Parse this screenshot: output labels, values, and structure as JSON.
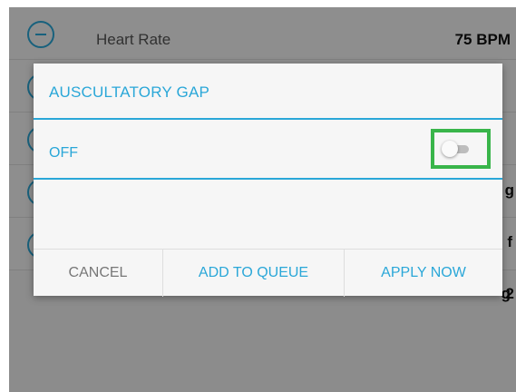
{
  "background": {
    "rows": [
      {
        "label": "Heart Rate",
        "value": "75 BPM"
      },
      {
        "label": "",
        "value": ""
      },
      {
        "label": "",
        "value": "g"
      },
      {
        "label": "",
        "value": "f"
      },
      {
        "label": "",
        "value": "2"
      }
    ]
  },
  "dialog": {
    "title": "AUSCULTATORY GAP",
    "option_label": "OFF",
    "toggle_state": "off",
    "buttons": {
      "cancel": "CANCEL",
      "add_to_queue": "ADD TO QUEUE",
      "apply_now": "APPLY NOW"
    }
  },
  "colors": {
    "accent": "#2aa7d8",
    "highlight_border": "#39b54a",
    "scrim": "rgba(0,0,0,0.42)"
  }
}
